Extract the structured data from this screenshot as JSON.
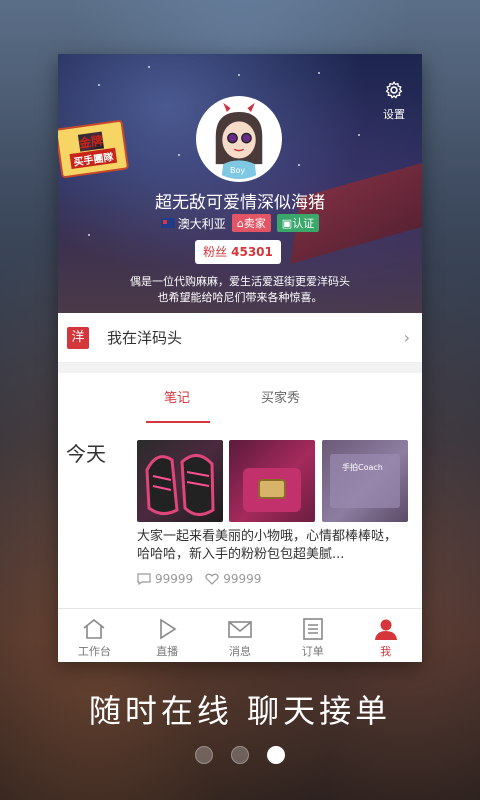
{
  "profile": {
    "name": "超无敌可爱情深似海猪",
    "country": "澳大利亚",
    "tag_seller": "卖家",
    "tag_verified": "认证",
    "fans_label": "粉丝",
    "fans_count": "45301",
    "bio_line1": "偶是一位代购麻麻，爱生活爱逛街更爱洋码头",
    "bio_line2": "也希望能给哈尼们带来各种惊喜。",
    "avatar_text": "Boy",
    "badge_line1": "金牌",
    "badge_line2": "买手團隊"
  },
  "header": {
    "settings_label": "设置"
  },
  "shop_row": {
    "icon_text": "洋",
    "label": "我在洋码头"
  },
  "tabs": [
    {
      "label": "笔记"
    },
    {
      "label": "买家秀"
    }
  ],
  "feed": {
    "date_label": "今天",
    "post_text": "大家一起来看美丽的小物哦，心情都棒棒哒，哈哈哈，新入手的粉粉包包超美腻...",
    "comments": "99999",
    "likes": "99999"
  },
  "nav": [
    {
      "label": "工作台",
      "icon": "home-icon"
    },
    {
      "label": "直播",
      "icon": "play-icon"
    },
    {
      "label": "消息",
      "icon": "mail-icon"
    },
    {
      "label": "订单",
      "icon": "list-icon"
    },
    {
      "label": "我",
      "icon": "user-icon"
    }
  ],
  "slogan": "随时在线  聊天接单",
  "pager": {
    "total": 3,
    "active": 3
  },
  "colors": {
    "accent": "#d4363b",
    "green": "#3aa86a",
    "pink": "#e35565"
  }
}
